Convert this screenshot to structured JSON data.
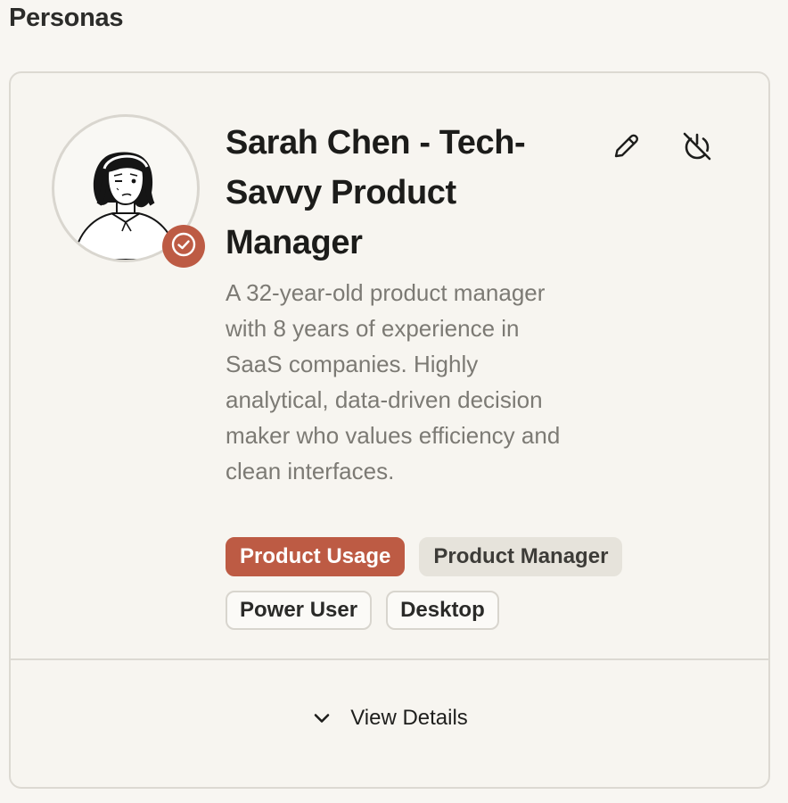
{
  "section": {
    "title": "Personas"
  },
  "persona": {
    "name": "Sarah Chen - Tech-Savvy Product Manager",
    "description": "A 32-year-old product manager with 8 years of experience in SaaS companies. Highly analytical, data-driven decision maker who values efficiency and clean interfaces.",
    "avatar_icon": "woman-portrait-illustration",
    "status_icon": "check-circle-icon",
    "tags": [
      {
        "label": "Product Usage",
        "style": "primary"
      },
      {
        "label": "Product Manager",
        "style": "muted"
      },
      {
        "label": "Power User",
        "style": "outline"
      },
      {
        "label": "Desktop",
        "style": "outline"
      }
    ],
    "actions": {
      "edit_icon": "pencil-icon",
      "toggle_icon": "power-off-icon"
    },
    "footer": {
      "view_details_label": "View Details",
      "chevron_icon": "chevron-down-icon"
    }
  },
  "colors": {
    "background": "#f8f6f2",
    "accent": "#bd5b44",
    "border": "#dcd9d2",
    "muted_tag": "#e6e3db",
    "description_text": "#7c7a74"
  }
}
